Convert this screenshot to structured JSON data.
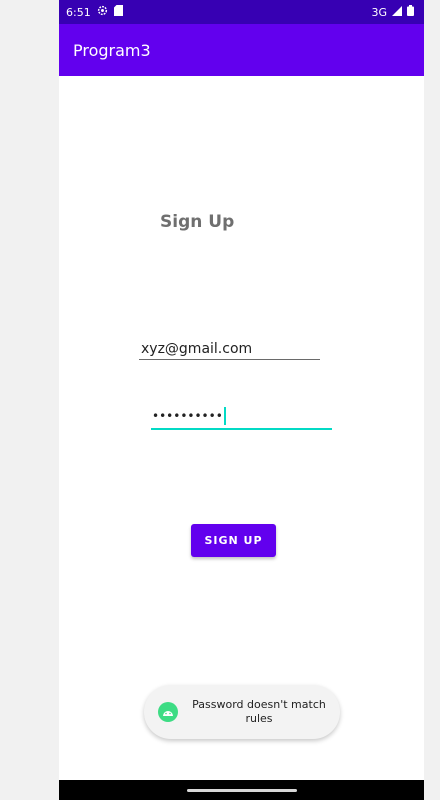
{
  "status_bar": {
    "time": "6:51",
    "network": "3G",
    "left_icons": [
      "settings-icon",
      "sd-card-icon"
    ],
    "right_icons": [
      "signal-icon",
      "battery-icon"
    ]
  },
  "app_bar": {
    "title": "Program3"
  },
  "form": {
    "heading": "Sign Up",
    "email": {
      "value": "xyz@gmail.com"
    },
    "password": {
      "value": "••••••••••"
    },
    "submit_label": "SIGN UP"
  },
  "toast": {
    "icon": "android-icon",
    "message": "Password doesn't match rules"
  },
  "colors": {
    "status_bar": "#3700b3",
    "primary": "#6200ee",
    "accent": "#03dac5",
    "toast_icon": "#3ddc84"
  }
}
